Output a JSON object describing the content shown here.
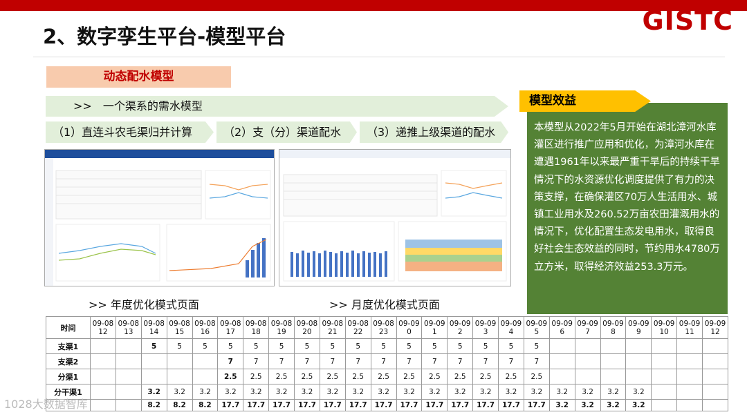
{
  "header": {
    "title": "2、数字孪生平台-模型平台",
    "logo": "GISTC"
  },
  "banner": "动态配水模型",
  "demand_model": ">>　一个渠系的需水模型",
  "steps": [
    "（1）直连斗农毛渠归并计算",
    "（2）支（分）渠道配水",
    "（3）递推上级渠道的配水"
  ],
  "captions": {
    "annual": ">> 年度优化模式页面",
    "monthly": ">> 月度优化模式页面"
  },
  "benefit": {
    "heading": "模型效益",
    "text": "本模型从2022年5月开始在湖北漳河水库灌区进行推广应用和优化，为漳河水库在遭遇1961年以来最严重干旱后的持续干旱情况下的水资源优化调度提供了有力的决策支撑，在确保灌区70万人生活用水、城镇工业用水及260.52万亩农田灌溉用水的情况下，优化配置生态发电用水，取得良好社会生态效益的同时，节约用水4780万立方米，取得经济效益253.3万元。"
  },
  "table": {
    "time_label": "时间",
    "times": [
      "09-08 12",
      "09-08 13",
      "09-08 14",
      "09-08 15",
      "09-08 16",
      "09-08 17",
      "09-08 18",
      "09-08 19",
      "09-08 20",
      "09-08 21",
      "09-08 22",
      "09-08 23",
      "09-09 0",
      "09-09 1",
      "09-09 2",
      "09-09 3",
      "09-09 4",
      "09-09 5",
      "09-09 6",
      "09-09 7",
      "09-09 8",
      "09-09 9",
      "09-09 10",
      "09-09 11",
      "09-09 12"
    ],
    "rows": [
      {
        "label": "支渠1",
        "values": [
          "",
          "",
          "5",
          "5",
          "5",
          "5",
          "5",
          "5",
          "5",
          "5",
          "5",
          "5",
          "5",
          "5",
          "5",
          "5",
          "5",
          "5",
          "",
          "",
          "",
          "",
          "",
          "",
          ""
        ]
      },
      {
        "label": "支渠2",
        "values": [
          "",
          "",
          "",
          "",
          "",
          "7",
          "7",
          "7",
          "7",
          "7",
          "7",
          "7",
          "7",
          "7",
          "7",
          "7",
          "7",
          "7",
          "",
          "",
          "",
          "",
          "",
          "",
          ""
        ]
      },
      {
        "label": "分渠1",
        "values": [
          "",
          "",
          "",
          "",
          "",
          "2.5",
          "2.5",
          "2.5",
          "2.5",
          "2.5",
          "2.5",
          "2.5",
          "2.5",
          "2.5",
          "2.5",
          "2.5",
          "2.5",
          "2.5",
          "",
          "",
          "",
          "",
          "",
          "",
          ""
        ]
      },
      {
        "label": "分干渠1",
        "values": [
          "",
          "",
          "3.2",
          "3.2",
          "3.2",
          "3.2",
          "3.2",
          "3.2",
          "3.2",
          "3.2",
          "3.2",
          "3.2",
          "3.2",
          "3.2",
          "3.2",
          "3.2",
          "3.2",
          "3.2",
          "3.2",
          "3.2",
          "3.2",
          "3.2",
          "",
          "",
          ""
        ]
      },
      {
        "label": "",
        "values": [
          "",
          "",
          "8.2",
          "8.2",
          "8.2",
          "17.7",
          "17.7",
          "17.7",
          "17.7",
          "17.7",
          "17.7",
          "17.7",
          "17.7",
          "17.7",
          "17.7",
          "17.7",
          "17.7",
          "17.7",
          "3.2",
          "3.2",
          "3.2",
          "3.2",
          "",
          "",
          ""
        ]
      }
    ]
  },
  "watermark": "1028大数据智库"
}
